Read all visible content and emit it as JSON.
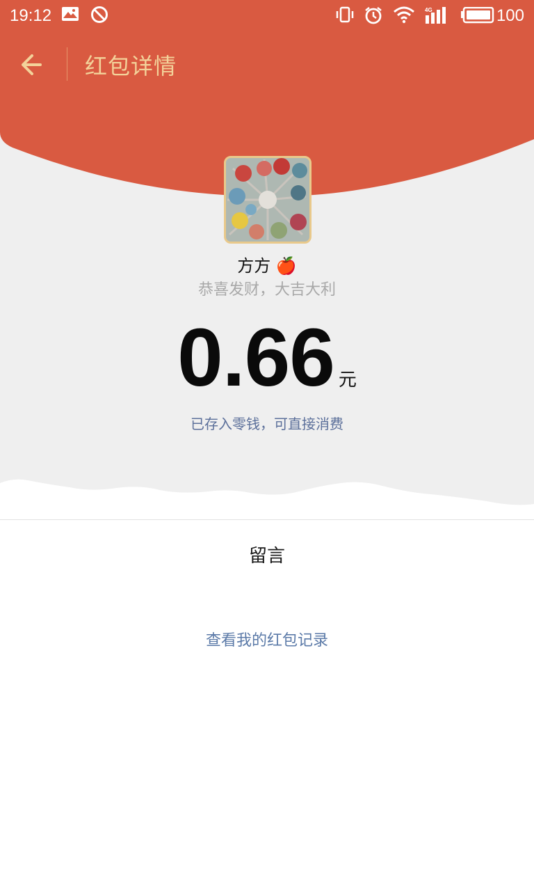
{
  "status_bar": {
    "time": "19:12",
    "network": "4G",
    "battery": "100",
    "icons": [
      "gallery-notification-icon",
      "do-not-disturb-icon",
      "vibrate-icon",
      "alarm-icon",
      "wifi-icon",
      "signal-icon",
      "battery-icon"
    ]
  },
  "header": {
    "back_icon": "arrow-left-icon",
    "title": "红包详情"
  },
  "colors": {
    "header_red": "#d95a41",
    "title_gold": "#f3d29a",
    "background_gray": "#efefef",
    "link_blue": "#5b7aa8"
  },
  "sender": {
    "name": "方方",
    "emoji": "🍎",
    "greeting": "恭喜发财，大吉大利"
  },
  "amount": {
    "value": "0.66",
    "unit": "元",
    "note": "已存入零钱，可直接消费"
  },
  "message_section": {
    "label": "留言"
  },
  "records_link": "查看我的红包记录"
}
